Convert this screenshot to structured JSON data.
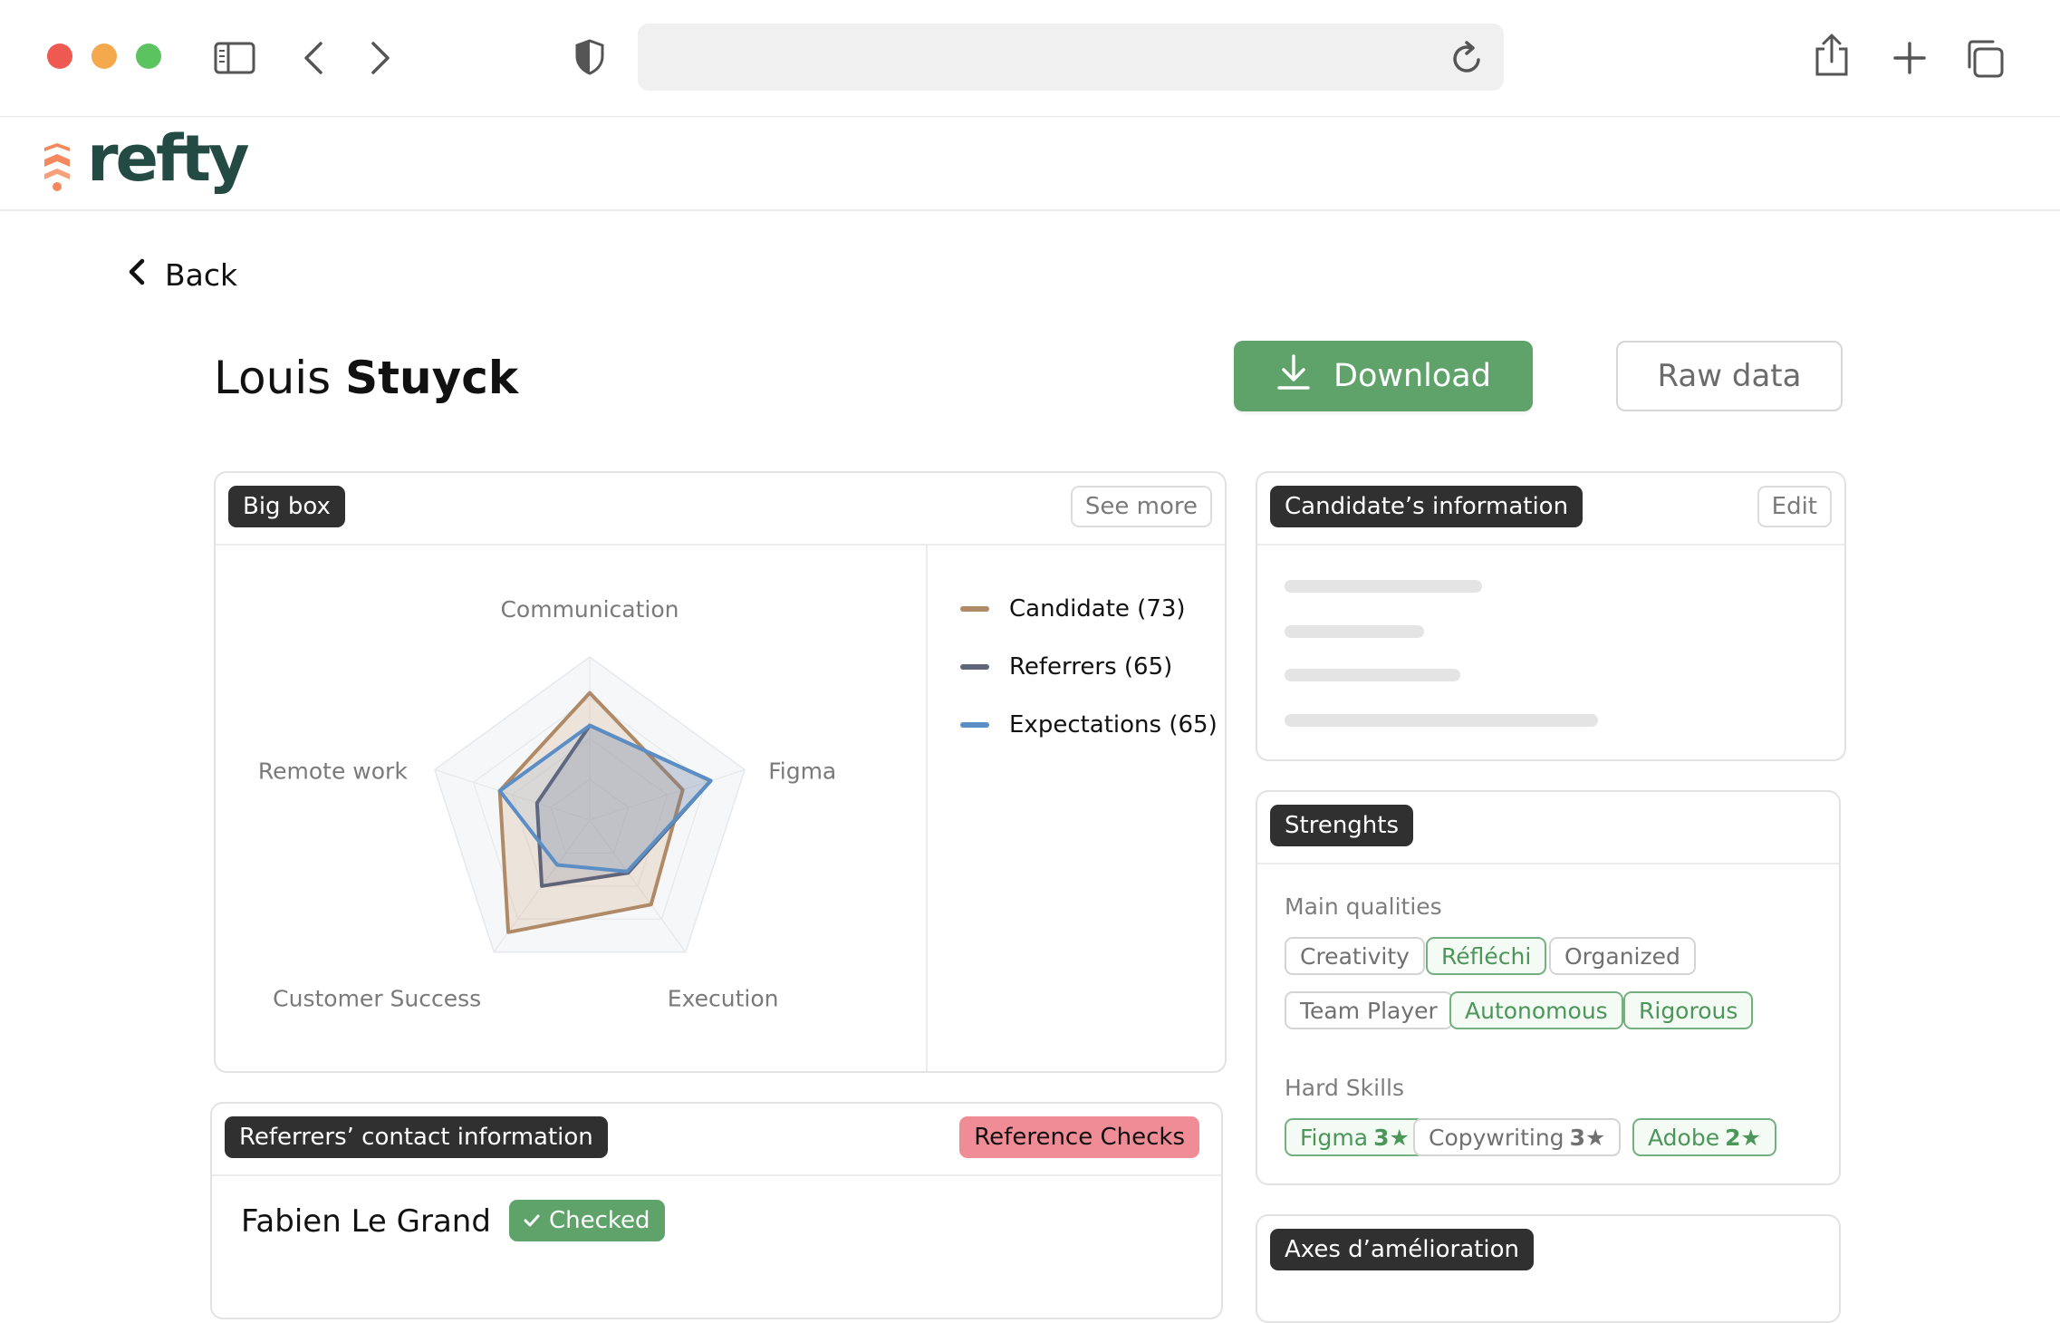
{
  "brand": {
    "name": "refty"
  },
  "nav": {
    "back_label": "Back"
  },
  "candidate": {
    "first_name": "Louis",
    "last_name": "Stuyck"
  },
  "actions": {
    "download_label": "Download",
    "raw_label": "Raw data"
  },
  "bigbox": {
    "title": "Big box",
    "see_more": "See more",
    "axes": [
      "Communication",
      "Figma",
      "Execution",
      "Customer Success",
      "Remote work"
    ],
    "legend": [
      {
        "label": "Candidate (73)",
        "color": "#b08a66"
      },
      {
        "label": "Referrers (65)",
        "color": "#5f6478"
      },
      {
        "label": "Expectations (65)",
        "color": "#5b8ec4"
      }
    ]
  },
  "chart_data": {
    "type": "radar",
    "axes": [
      "Communication",
      "Figma",
      "Execution",
      "Customer Success",
      "Remote work"
    ],
    "max": 100,
    "series": [
      {
        "name": "Candidate (73)",
        "color": "#b08a66",
        "values": [
          78,
          60,
          64,
          85,
          58
        ]
      },
      {
        "name": "Referrers (65)",
        "color": "#5f6478",
        "values": [
          58,
          78,
          40,
          50,
          34
        ]
      },
      {
        "name": "Expectations (65)",
        "color": "#5b8ec4",
        "values": [
          58,
          78,
          39,
          34,
          58
        ]
      }
    ]
  },
  "candidate_info": {
    "title": "Candidate’s information",
    "edit_label": "Edit"
  },
  "strengths": {
    "title": "Strenghts",
    "main_label": "Main qualities",
    "qualities": [
      {
        "label": "Creativity",
        "selected": false
      },
      {
        "label": "Réfléchi",
        "selected": true
      },
      {
        "label": "Organized",
        "selected": false
      },
      {
        "label": "Team Player",
        "selected": false
      },
      {
        "label": "Autonomous",
        "selected": true
      },
      {
        "label": "Rigorous",
        "selected": true
      }
    ],
    "hard_label": "Hard Skills",
    "skills": [
      {
        "label": "Figma",
        "level": "3★",
        "selected": true
      },
      {
        "label": "Copywriting",
        "level": "3★",
        "selected": false
      },
      {
        "label": "Adobe",
        "level": "2★",
        "selected": true
      }
    ]
  },
  "improvement": {
    "title": "Axes d’amélioration"
  },
  "referrers": {
    "title": "Referrers’ contact information",
    "ref_checks": "Reference Checks",
    "first": {
      "name": "Fabien Le Grand",
      "status": "Checked"
    }
  }
}
